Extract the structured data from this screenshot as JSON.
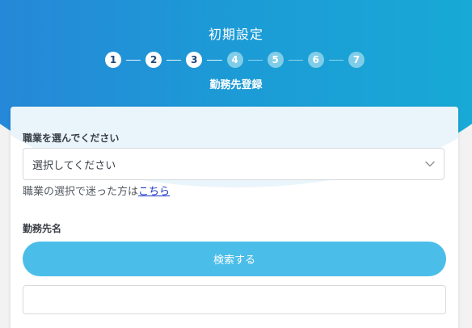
{
  "header": {
    "title": "初期設定",
    "subtitle": "勤務先登録",
    "steps": [
      {
        "label": "1",
        "state": "done"
      },
      {
        "label": "2",
        "state": "done"
      },
      {
        "label": "3",
        "state": "done"
      },
      {
        "label": "4",
        "state": "todo"
      },
      {
        "label": "5",
        "state": "todo"
      },
      {
        "label": "6",
        "state": "todo"
      },
      {
        "label": "7",
        "state": "todo"
      }
    ]
  },
  "form": {
    "occupation_label": "職業を選んでください",
    "occupation_select_value": "選択してください",
    "help_text": "職業の選択で迷った方は",
    "help_link": "こちら",
    "workplace_label": "勤務先名",
    "search_button": "検索する",
    "workplace_input_value": ""
  },
  "colors": {
    "header_gradient_start": "#2a7fd9",
    "header_gradient_end": "#16b0d6",
    "search_button": "#4bbde9",
    "step_done": "#ffffff",
    "step_todo": "#7fcde8",
    "link": "#1a35c9"
  },
  "icons": {
    "select_arrow": "chevron-down-icon"
  }
}
